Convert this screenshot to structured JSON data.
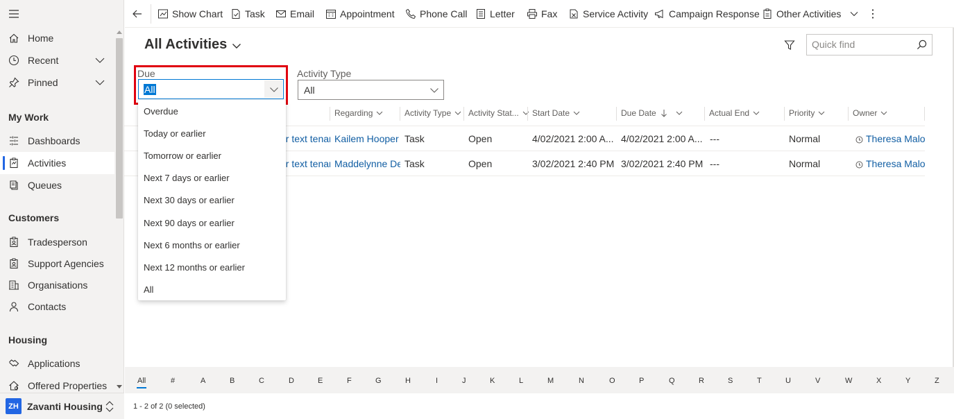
{
  "sidebar": {
    "items_top": [
      {
        "label": "Home",
        "icon": "home-icon"
      },
      {
        "label": "Recent",
        "icon": "clock-icon"
      },
      {
        "label": "Pinned",
        "icon": "pin-icon"
      }
    ],
    "sections": [
      {
        "title": "My Work",
        "items": [
          "Dashboards",
          "Activities",
          "Queues"
        ]
      },
      {
        "title": "Customers",
        "items": [
          "Tradesperson",
          "Support Agencies",
          "Organisations",
          "Contacts"
        ]
      },
      {
        "title": "Housing",
        "items": [
          "Applications",
          "Offered Properties"
        ]
      }
    ],
    "active_item": "Activities",
    "area": {
      "badge": "ZH",
      "name": "Zavanti Housing"
    }
  },
  "commands": [
    {
      "label": "Show Chart",
      "icon": "chart-icon"
    },
    {
      "label": "Task",
      "icon": "task-icon"
    },
    {
      "label": "Email",
      "icon": "email-icon"
    },
    {
      "label": "Appointment",
      "icon": "calendar-icon"
    },
    {
      "label": "Phone Call",
      "icon": "phone-icon"
    },
    {
      "label": "Letter",
      "icon": "letter-icon"
    },
    {
      "label": "Fax",
      "icon": "fax-icon"
    },
    {
      "label": "Service Activity",
      "icon": "service-icon"
    },
    {
      "label": "Campaign Response",
      "icon": "megaphone-icon"
    },
    {
      "label": "Other Activities",
      "icon": "clipboard-icon"
    }
  ],
  "view": {
    "title": "All Activities",
    "quick_find_placeholder": "Quick find"
  },
  "filters": {
    "due": {
      "label": "Due",
      "value": "All"
    },
    "activity_type": {
      "label": "Activity Type",
      "value": "All"
    }
  },
  "due_options": [
    "Overdue",
    "Today or earlier",
    "Tomorrow or earlier",
    "Next 7 days or earlier",
    "Next 30 days or earlier",
    "Next 90 days or earlier",
    "Next 6 months or earlier",
    "Next 12 months or earlier",
    "All"
  ],
  "columns": [
    "Regarding",
    "Activity Type",
    "Activity Stat...",
    "Start Date",
    "Due Date",
    "Actual End",
    "Priority",
    "Owner"
  ],
  "rows": [
    {
      "subject": "or text tenar",
      "regarding": "Kailem Hooper",
      "type": "Task",
      "status": "Open",
      "start": "4/02/2021 2:00 A...",
      "due": "4/02/2021 2:00 A...",
      "actual_end": "---",
      "priority": "Normal",
      "owner": "Theresa Malone"
    },
    {
      "subject": "or text tenar",
      "regarding": "Maddelynne Deb",
      "type": "Task",
      "status": "Open",
      "start": "3/02/2021 2:40 PM",
      "due": "3/02/2021 2:40 PM",
      "actual_end": "---",
      "priority": "Normal",
      "owner": "Theresa Malone"
    }
  ],
  "jump_letters": [
    "All",
    "#",
    "A",
    "B",
    "C",
    "D",
    "E",
    "F",
    "G",
    "H",
    "I",
    "J",
    "K",
    "L",
    "M",
    "N",
    "O",
    "P",
    "Q",
    "R",
    "S",
    "T",
    "U",
    "V",
    "W",
    "X",
    "Y",
    "Z"
  ],
  "status_text": "1 - 2 of 2 (0 selected)"
}
